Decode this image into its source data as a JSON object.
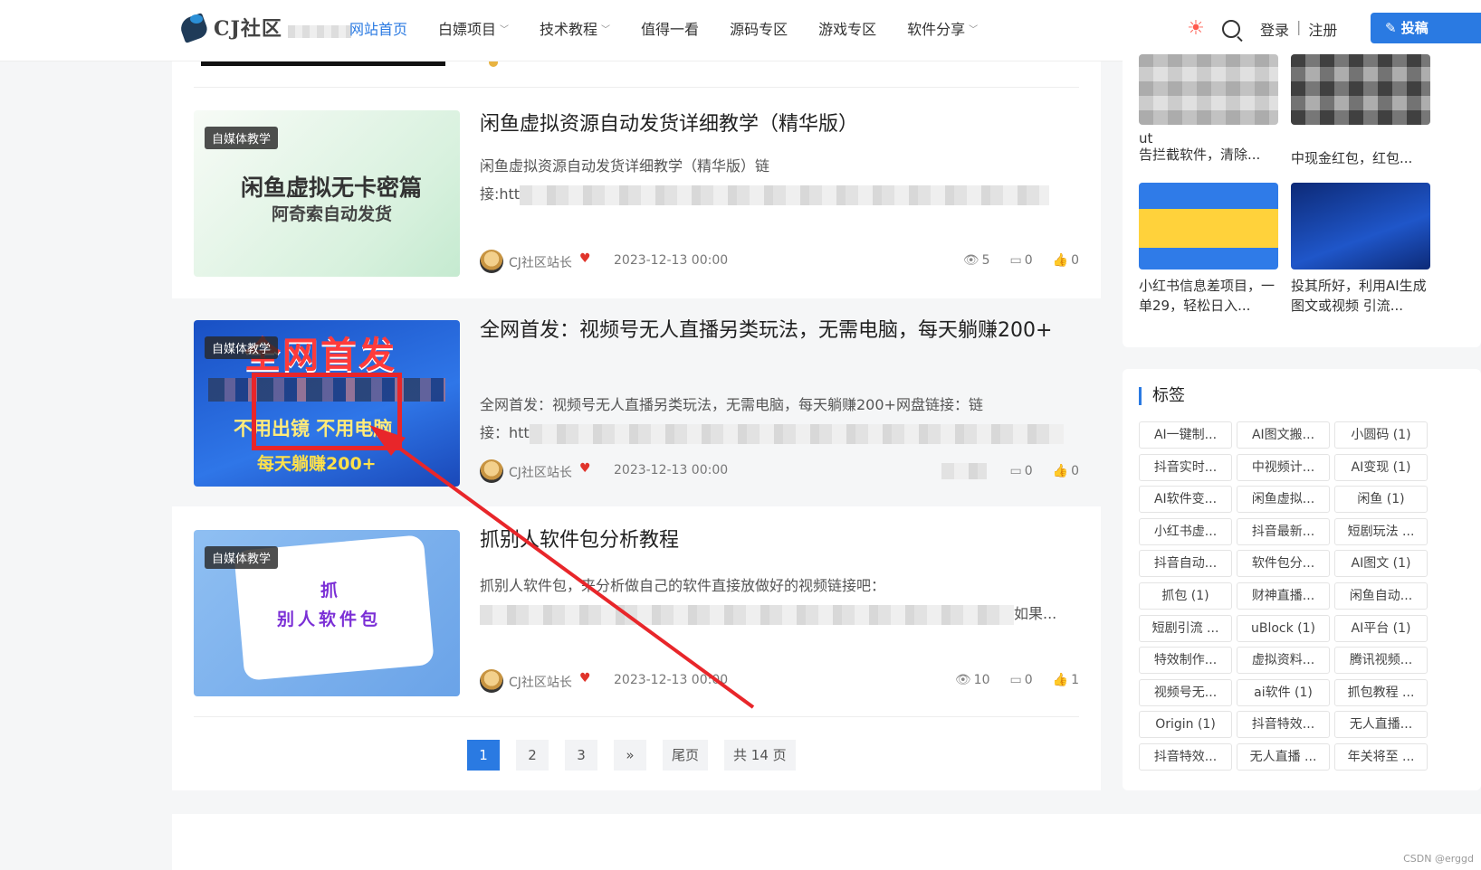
{
  "header": {
    "logo_text": "CJ社区",
    "nav": [
      {
        "label": "网站首页",
        "active": true,
        "dropdown": false
      },
      {
        "label": "白嫖项目",
        "active": false,
        "dropdown": true
      },
      {
        "label": "技术教程",
        "active": false,
        "dropdown": true
      },
      {
        "label": "值得一看",
        "active": false,
        "dropdown": false
      },
      {
        "label": "源码专区",
        "active": false,
        "dropdown": false
      },
      {
        "label": "游戏专区",
        "active": false,
        "dropdown": false
      },
      {
        "label": "软件分享",
        "active": false,
        "dropdown": true
      }
    ],
    "login": "登录",
    "separator": "|",
    "register": "注册",
    "post_button": "投稿"
  },
  "posts": [
    {
      "category": "自媒体教学",
      "thumb_line1": "闲鱼虚拟无卡密篇",
      "thumb_line2": "阿奇索自动发货",
      "title": "闲鱼虚拟资源自动发货详细教学（精华版）",
      "excerpt_line1": "闲鱼虚拟资源自动发货详细教学（精华版）链",
      "excerpt_line2_prefix": "接:htt",
      "excerpt_line2_suffix": "",
      "author": "CJ社区站长",
      "date": "2023-12-13 00:00",
      "views": "5",
      "comments": "0",
      "likes": "0"
    },
    {
      "category": "自媒体教学",
      "thumb_line1": "全网首发",
      "thumb_line2": "不用出镜 不用电脑",
      "thumb_line3": "每天躺赚200+",
      "title": "全网首发：视频号无人直播另类玩法，无需电脑，每天躺赚200+",
      "excerpt_line1": "全网首发：视频号无人直播另类玩法，无需电脑，每天躺赚200+网盘链接：链",
      "excerpt_line2_prefix": "接：htt",
      "excerpt_line2_suffix": "",
      "author": "CJ社区站长",
      "date": "2023-12-13 00:00",
      "views": "",
      "comments": "0",
      "likes": "0"
    },
    {
      "category": "自媒体教学",
      "thumb_line1": "抓",
      "thumb_line2": "别人软件包",
      "title": "抓别人软件包分析教程",
      "excerpt_line1": "抓别人软件包，来分析做自己的软件直接放做好的视频链接吧：",
      "excerpt_line2_prefix": "",
      "excerpt_line2_suffix": "如果...",
      "author": "CJ社区站长",
      "date": "2023-12-13 00:00",
      "views": "10",
      "comments": "0",
      "likes": "1"
    }
  ],
  "pagination": {
    "pages": [
      "1",
      "2",
      "3"
    ],
    "current": "1",
    "next": "»",
    "last": "尾页",
    "total": "共 14 页"
  },
  "sidebar": {
    "recommended": [
      {
        "caption": "告拦截软件，清除..."
      },
      {
        "caption": "中现金红包，红包..."
      },
      {
        "caption": "小红书信息差项目，一单29，轻松日入..."
      },
      {
        "caption": "投其所好，利用AI生成图文或视频 引流..."
      }
    ],
    "recommended_partial": "ut",
    "tags_title": "标签",
    "tags": [
      "AI一键制...",
      "AI图文搬...",
      "小圆码 (1)",
      "抖音实时...",
      "中视频计...",
      "AI变现 (1)",
      "AI软件变...",
      "闲鱼虚拟...",
      "闲鱼 (1)",
      "小红书虚...",
      "抖音最新...",
      "短剧玩法 ...",
      "抖音自动...",
      "软件包分...",
      "AI图文 (1)",
      "抓包 (1)",
      "财神直播...",
      "闲鱼自动...",
      "短剧引流 ...",
      "uBlock (1)",
      "AI平台 (1)",
      "特效制作...",
      "虚拟资料...",
      "腾讯视频...",
      "视频号无...",
      "ai软件 (1)",
      "抓包教程 ...",
      "Origin (1)",
      "抖音特效...",
      "无人直播...",
      "抖音特效...",
      "无人直播 ...",
      "年关将至 ..."
    ]
  },
  "watermark": "CSDN @erggd",
  "colors": {
    "accent": "#2a7ae2",
    "heart": "#e0342b",
    "annotation": "#e8262a"
  }
}
